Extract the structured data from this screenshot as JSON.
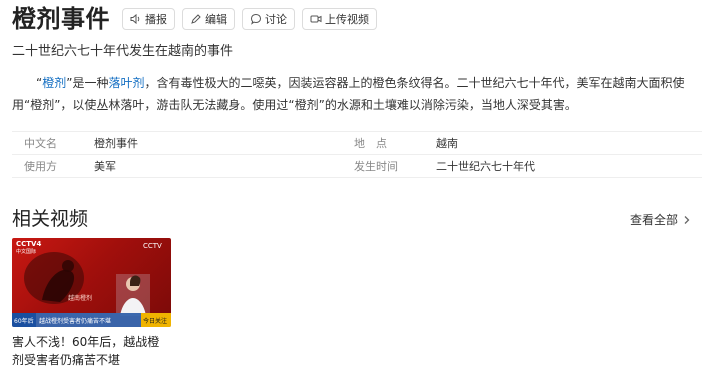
{
  "header": {
    "title": "橙剂事件",
    "buttons": [
      {
        "label": "播报",
        "icon": "speaker-icon"
      },
      {
        "label": "编辑",
        "icon": "pencil-icon"
      },
      {
        "label": "讨论",
        "icon": "chat-bubble-icon"
      },
      {
        "label": "上传视频",
        "icon": "video-camera-icon"
      }
    ]
  },
  "subtitle": "二十世纪六七十年代发生在越南的事件",
  "summary": {
    "open_quote": "“",
    "link1": "橙剂",
    "text1": "”是一种",
    "link2": "落叶剂",
    "text2": "，含有毒性极大的二噁英，因装运容器上的橙色条纹得名。二十世纪六七十年代，美军在越南大面积使用“橙剂”，以使丛林落叶，游击队无法藏身。使用过“橙剂”的水源和土壤难以消除污染，当地人深受其害。"
  },
  "basic_info": [
    {
      "k1": "中文名",
      "v1": "橙剂事件",
      "k2": "地　点",
      "v2": "越南"
    },
    {
      "k1": "使用方",
      "v1": "美军",
      "k2": "发生时间",
      "v2": "二十世纪六七十年代"
    }
  ],
  "related_videos": {
    "title": "相关视频",
    "see_all": "查看全部",
    "items": [
      {
        "caption": "害人不浅！60年后，越战橙剂受害者仍痛苦不堪",
        "overlay": {
          "logo": "CCTV4",
          "logo_sub": "中文国际",
          "channel": "CCTV",
          "mid_text": "越南橙剂",
          "ticker_num": "60年后",
          "ticker_text": "越战橙剂受害者仍痛苦不堪",
          "ticker_tag": "今日关注"
        }
      }
    ]
  },
  "colors": {
    "link": "#136ec2",
    "thumb_red": "#c81812",
    "ticker_blue": "#1a4fa0"
  }
}
